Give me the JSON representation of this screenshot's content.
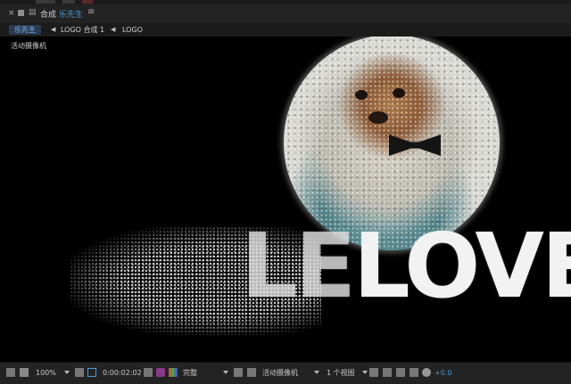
{
  "panel": {
    "close_glyph": "×",
    "title_prefix": "合成",
    "comp_name": "乐先生",
    "menu_glyph": "≡"
  },
  "breadcrumbs": [
    {
      "label": "乐先生",
      "active": true
    },
    {
      "label": "LOGO 合成 1",
      "active": false
    },
    {
      "label": "LOGO",
      "active": false
    }
  ],
  "viewer": {
    "camera_label": "活动摄像机",
    "logo_text": "LOVEL",
    "logo_text_faded": "LE"
  },
  "toolbar": {
    "zoom": "100%",
    "timecode": "0:00:02:02",
    "resolution": "完整",
    "camera": "活动摄像机",
    "views": "1 个视图",
    "exposure": "+0.0"
  },
  "colors": {
    "accent": "#4a9ad8",
    "panel_bg": "#232323",
    "viewer_bg": "#000000"
  }
}
